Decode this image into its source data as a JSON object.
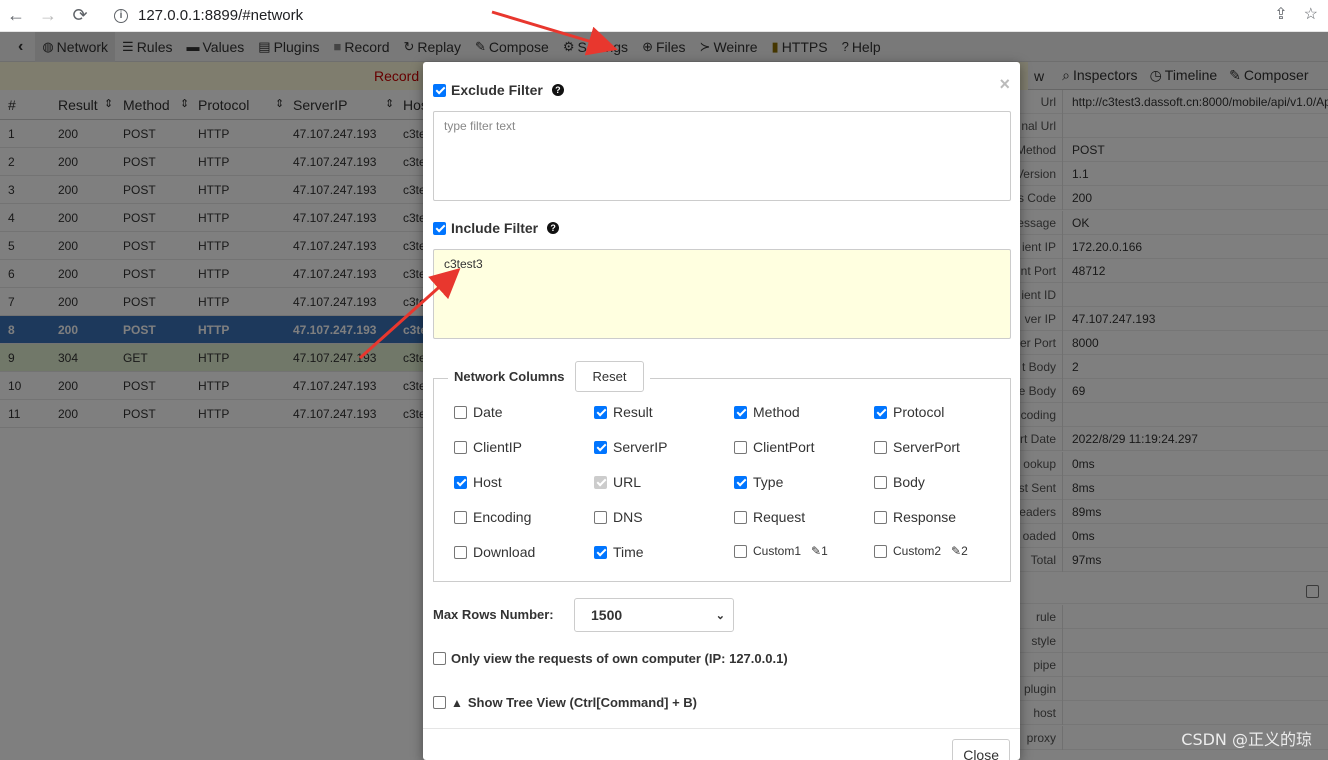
{
  "browser": {
    "back": "←",
    "forward": "→",
    "reload": "⟳",
    "url": "127.0.0.1:8899/#network",
    "share_icon": "share-icon",
    "star_icon": "star-icon"
  },
  "toolbar": {
    "items": [
      {
        "label": "Network",
        "icon": "globe-icon"
      },
      {
        "label": "Rules",
        "icon": "list-icon"
      },
      {
        "label": "Values",
        "icon": "folder-icon"
      },
      {
        "label": "Plugins",
        "icon": "plugin-icon"
      },
      {
        "label": "Record",
        "icon": "record-icon"
      },
      {
        "label": "Replay",
        "icon": "replay-icon"
      },
      {
        "label": "Compose",
        "icon": "edit-icon"
      },
      {
        "label": "Settings",
        "icon": "gear-icon"
      },
      {
        "label": "Files",
        "icon": "upload-icon"
      },
      {
        "label": "Weinre",
        "icon": "terminal-icon"
      },
      {
        "label": "HTTPS",
        "icon": "lock-icon"
      },
      {
        "label": "Help",
        "icon": "help-icon"
      }
    ]
  },
  "recordbar": {
    "text": "Record"
  },
  "list": {
    "headers": [
      "#",
      "Result",
      "Method",
      "Protocol",
      "ServerIP",
      "Hos"
    ],
    "rows": [
      {
        "n": "1",
        "result": "200",
        "method": "POST",
        "protocol": "HTTP",
        "ip": "47.107.247.193",
        "host": "c3te"
      },
      {
        "n": "2",
        "result": "200",
        "method": "POST",
        "protocol": "HTTP",
        "ip": "47.107.247.193",
        "host": "c3te"
      },
      {
        "n": "3",
        "result": "200",
        "method": "POST",
        "protocol": "HTTP",
        "ip": "47.107.247.193",
        "host": "c3te"
      },
      {
        "n": "4",
        "result": "200",
        "method": "POST",
        "protocol": "HTTP",
        "ip": "47.107.247.193",
        "host": "c3te"
      },
      {
        "n": "5",
        "result": "200",
        "method": "POST",
        "protocol": "HTTP",
        "ip": "47.107.247.193",
        "host": "c3te"
      },
      {
        "n": "6",
        "result": "200",
        "method": "POST",
        "protocol": "HTTP",
        "ip": "47.107.247.193",
        "host": "c3te"
      },
      {
        "n": "7",
        "result": "200",
        "method": "POST",
        "protocol": "HTTP",
        "ip": "47.107.247.193",
        "host": "c3te"
      },
      {
        "n": "8",
        "result": "200",
        "method": "POST",
        "protocol": "HTTP",
        "ip": "47.107.247.193",
        "host": "c3te"
      },
      {
        "n": "9",
        "result": "304",
        "method": "GET",
        "protocol": "HTTP",
        "ip": "47.107.247.193",
        "host": "c3te"
      },
      {
        "n": "10",
        "result": "200",
        "method": "POST",
        "protocol": "HTTP",
        "ip": "47.107.247.193",
        "host": "c3te"
      },
      {
        "n": "11",
        "result": "200",
        "method": "POST",
        "protocol": "HTTP",
        "ip": "47.107.247.193",
        "host": "c3te"
      }
    ]
  },
  "right_tabs": [
    {
      "label": "w",
      "icon": ""
    },
    {
      "label": "Inspectors",
      "icon": "search-icon"
    },
    {
      "label": "Timeline",
      "icon": "clock-icon"
    },
    {
      "label": "Composer",
      "icon": "edit-icon"
    }
  ],
  "details": [
    {
      "label": "Url",
      "value": "http://c3test3.dassoft.cn:8000/mobile/api/v1.0/Ap"
    },
    {
      "label": "nal Url",
      "value": ""
    },
    {
      "label": "Method",
      "value": "POST"
    },
    {
      "label": "Version",
      "value": "1.1"
    },
    {
      "label": "s Code",
      "value": "200"
    },
    {
      "label": "essage",
      "value": "OK"
    },
    {
      "label": "ient IP",
      "value": "172.20.0.166"
    },
    {
      "label": "nt Port",
      "value": "48712"
    },
    {
      "label": "ient ID",
      "value": ""
    },
    {
      "label": "ver IP",
      "value": "47.107.247.193"
    },
    {
      "label": "er Port",
      "value": "8000"
    },
    {
      "label": "t Body",
      "value": "2"
    },
    {
      "label": "e Body",
      "value": "69"
    },
    {
      "label": "coding",
      "value": ""
    },
    {
      "label": "rt Date",
      "value": "2022/8/29 11:19:24.297"
    },
    {
      "label": "ookup",
      "value": "0ms"
    },
    {
      "label": "st Sent",
      "value": "8ms"
    },
    {
      "label": "eaders",
      "value": "89ms"
    },
    {
      "label": "oaded",
      "value": "0ms"
    },
    {
      "label": "Total",
      "value": "97ms"
    }
  ],
  "details2": [
    {
      "label": "rule",
      "value": ""
    },
    {
      "label": "style",
      "value": ""
    },
    {
      "label": "pipe",
      "value": ""
    },
    {
      "label": "plugin",
      "value": ""
    },
    {
      "label": "host",
      "value": ""
    },
    {
      "label": "proxy",
      "value": ""
    }
  ],
  "modal": {
    "close_x": "×",
    "exclude_label": "Exclude Filter",
    "exclude_checked": true,
    "exclude_placeholder": "type filter text",
    "include_label": "Include Filter",
    "include_checked": true,
    "include_value": "c3test3",
    "columns_legend": "Network Columns",
    "reset_label": "Reset",
    "columns": [
      {
        "label": "Date",
        "checked": false
      },
      {
        "label": "Result",
        "checked": true
      },
      {
        "label": "Method",
        "checked": true
      },
      {
        "label": "Protocol",
        "checked": true
      },
      {
        "label": "ClientIP",
        "checked": false
      },
      {
        "label": "ServerIP",
        "checked": true
      },
      {
        "label": "ClientPort",
        "checked": false
      },
      {
        "label": "ServerPort",
        "checked": false
      },
      {
        "label": "Host",
        "checked": true
      },
      {
        "label": "URL",
        "checked": "disabled"
      },
      {
        "label": "Type",
        "checked": true
      },
      {
        "label": "Body",
        "checked": false
      },
      {
        "label": "Encoding",
        "checked": false
      },
      {
        "label": "DNS",
        "checked": false
      },
      {
        "label": "Request",
        "checked": false
      },
      {
        "label": "Response",
        "checked": false
      },
      {
        "label": "Download",
        "checked": false
      },
      {
        "label": "Time",
        "checked": true
      },
      {
        "label": "Custom1",
        "checked": false,
        "edit": "1"
      },
      {
        "label": "Custom2",
        "checked": false,
        "edit": "2"
      }
    ],
    "max_rows_label": "Max Rows Number:",
    "max_rows_value": "1500",
    "own_requests_label": "Only view the requests of own computer (IP: 127.0.0.1)",
    "tree_view_label": "Show Tree View (Ctrl[Command] + B)",
    "close_label": "Close"
  },
  "watermark": "CSDN @正义的琼",
  "colors": {
    "accent": "#0075ff",
    "selected_row": "#3b73b9",
    "annotation": "#e8372e"
  }
}
